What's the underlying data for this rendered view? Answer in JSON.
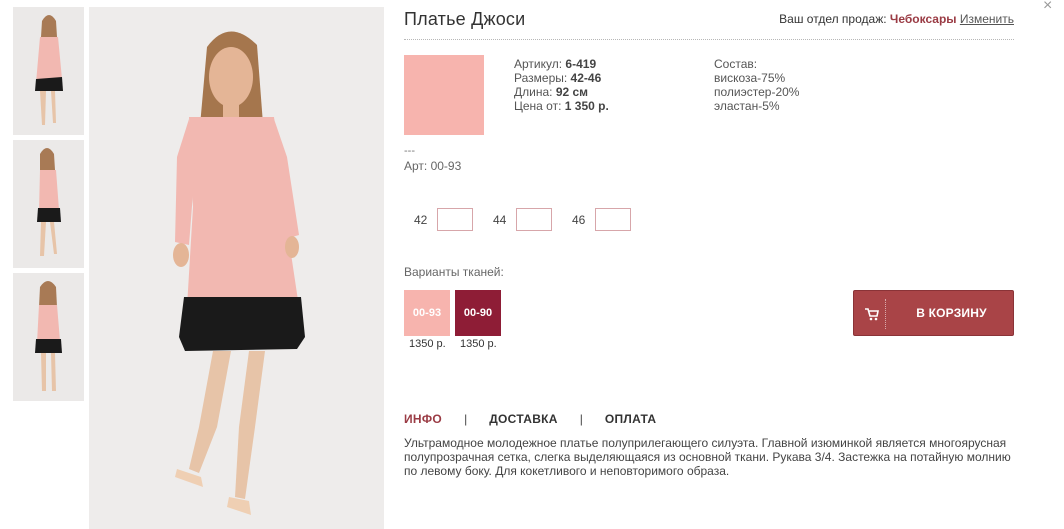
{
  "product": {
    "title": "Платье Джоси",
    "region_label": "Ваш отдел продаж:",
    "region_city": "Чебоксары",
    "region_change": "Изменить"
  },
  "specs": {
    "article_label": "Артикул:",
    "article_value": "6-419",
    "sizes_label": "Размеры:",
    "sizes_value": "42-46",
    "length_label": "Длина:",
    "length_value": "92 см",
    "price_label": "Цена от:",
    "price_value": "1 350 р."
  },
  "composition": {
    "label": "Состав:",
    "items": [
      "вискоза-75%",
      "полиэстер-20%",
      "эластан-5%"
    ]
  },
  "swatch": {
    "color": "#f7b4ae",
    "dashes": "---",
    "art": "Арт: 00-93"
  },
  "sizes": [
    {
      "label": "42",
      "value": ""
    },
    {
      "label": "44",
      "value": ""
    },
    {
      "label": "46",
      "value": ""
    }
  ],
  "variants": {
    "label": "Варианты тканей:",
    "items": [
      {
        "code": "00-93",
        "price": "1350 р.",
        "color": "#f7b4ae"
      },
      {
        "code": "00-90",
        "price": "1350 р.",
        "color": "#8e1d36"
      }
    ]
  },
  "cart": {
    "label": "В КОРЗИНУ",
    "color": "#a94447"
  },
  "tabs": {
    "info": "ИНФО",
    "delivery": "ДОСТАВКА",
    "payment": "ОПЛАТА",
    "separator": "|"
  },
  "description": "Ультрамодное молодежное платье полуприлегающего силуэта. Главной изюминкой является многоярусная полупрозрачная сетка, слегка выделяющаяся из основной ткани. Рукава 3/4. Застежка на потайную молнию по левому боку. Для кокетливого и неповторимого образа.",
  "close": "×",
  "colors": {
    "accent": "#9a3b44",
    "dress": "#f2b8b1",
    "tulle": "#1a1a1a"
  }
}
